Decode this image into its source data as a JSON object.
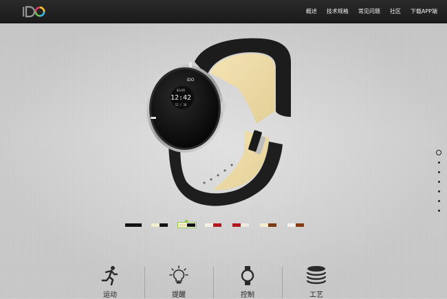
{
  "nav": {
    "logo_text": "iDO",
    "items": [
      {
        "label": "概述"
      },
      {
        "label": "技术规格"
      },
      {
        "label": "常见问题"
      },
      {
        "label": "社区"
      },
      {
        "label": "下载APP端"
      }
    ]
  },
  "hero": {
    "watch_brand": "iDO",
    "watch_date": "03/05",
    "watch_time": "12:42",
    "watch_day": "12 / 26"
  },
  "color_options": [
    {
      "colors": [
        "#111111",
        "#111111"
      ],
      "selected": false
    },
    {
      "colors": [
        "#f2ecd0",
        "#111111"
      ],
      "selected": false
    },
    {
      "colors": [
        "#e9e3b8",
        "#111111"
      ],
      "selected": true
    },
    {
      "colors": [
        "#f4f0e6",
        "#b0181e"
      ],
      "selected": false
    },
    {
      "colors": [
        "#b0181e",
        "#f0ebe0"
      ],
      "selected": false
    },
    {
      "colors": [
        "#f3ecd0",
        "#7a3b10"
      ],
      "selected": false
    },
    {
      "colors": [
        "#f2f0ec",
        "#8a3a12"
      ],
      "selected": false
    }
  ],
  "page_indicator": {
    "count": 7,
    "active_index": 0
  },
  "features": [
    {
      "label": "运动",
      "icon": "running-icon"
    },
    {
      "label": "提醒",
      "icon": "lightbulb-icon"
    },
    {
      "label": "控制",
      "icon": "watch-icon"
    },
    {
      "label": "工艺",
      "icon": "layers-icon"
    }
  ],
  "colors": {
    "accent": "#8cc63f",
    "topbar": "#1f1f1f"
  }
}
